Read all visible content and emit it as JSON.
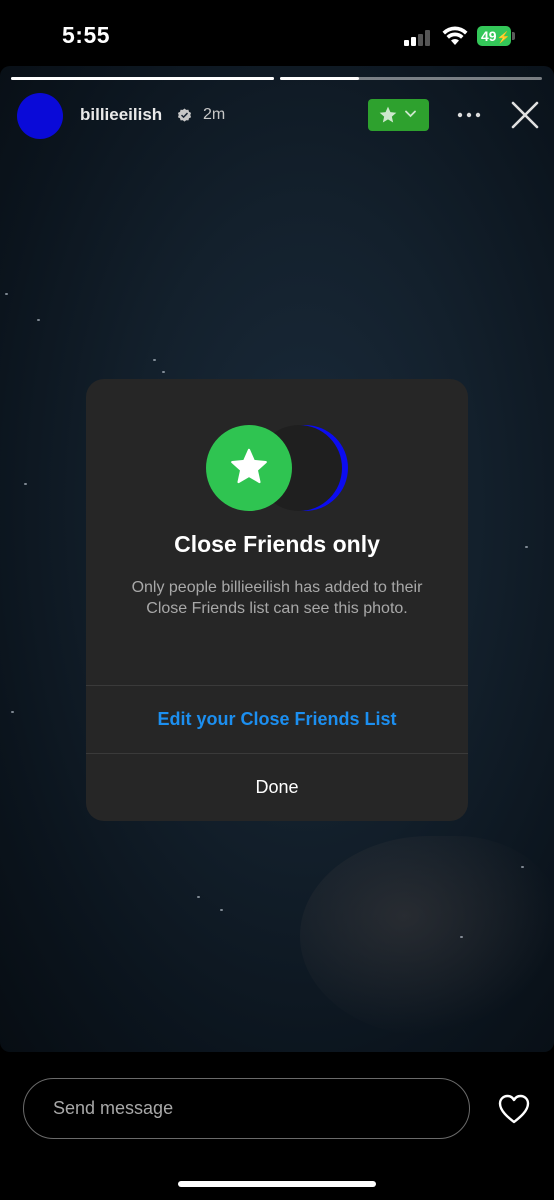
{
  "status_bar": {
    "time": "5:55",
    "battery": "49"
  },
  "story": {
    "username": "billieeilish",
    "time_ago": "2m",
    "progress": [
      1.0,
      0.3
    ],
    "avatar_color": "#0a0ad8",
    "badge_color": "#2ea12e",
    "icons": [
      "verified-icon",
      "star-icon",
      "chevron-down-icon",
      "more-icon",
      "close-icon"
    ]
  },
  "modal": {
    "title": "Close Friends only",
    "description": "Only people billieeilish has added to their Close Friends list can see this photo.",
    "edit_label": "Edit your Close Friends List",
    "done_label": "Done",
    "accent_green": "#2fc451",
    "accent_blue": "#0c0cf0",
    "link_color": "#1c8ff0"
  },
  "footer": {
    "message_placeholder": "Send message",
    "like_icon": "heart-icon"
  }
}
